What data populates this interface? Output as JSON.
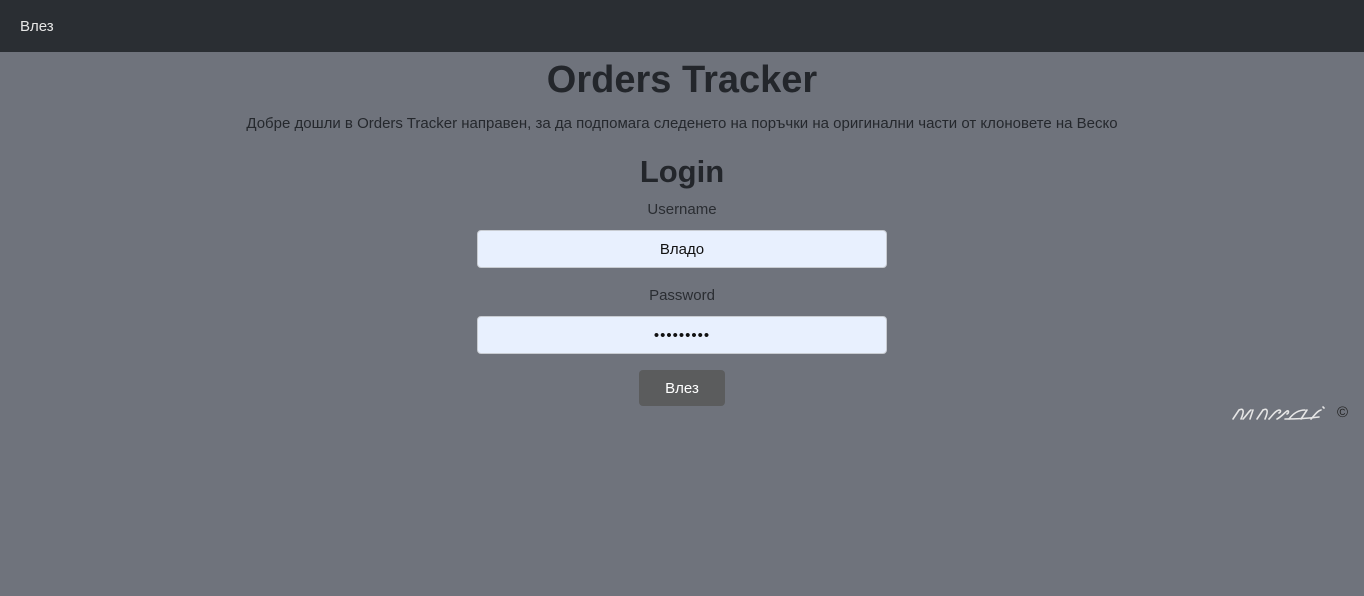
{
  "nav": {
    "login_link": "Влез"
  },
  "header": {
    "title": "Orders Tracker",
    "subtitle": "Добре дошли в Orders Tracker направен, за да подпомага следенето на поръчки на оригинални части от клоновете на Веско"
  },
  "login": {
    "title": "Login",
    "username_label": "Username",
    "username_value": "Владо",
    "password_label": "Password",
    "password_value": "•••••••••",
    "submit_label": "Влез"
  },
  "footer": {
    "signature": "ninci",
    "copyright_symbol": "©"
  }
}
